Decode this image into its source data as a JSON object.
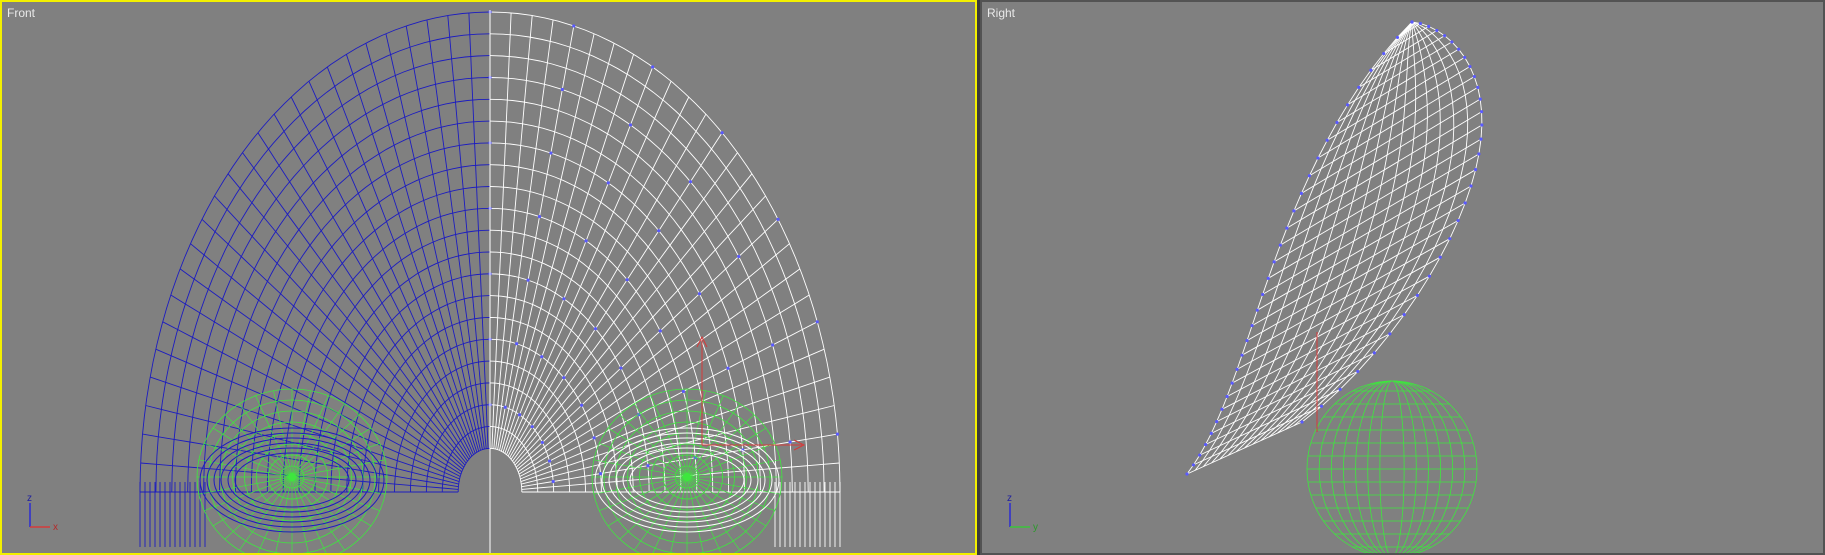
{
  "viewports": [
    {
      "label": "Front",
      "active": true,
      "axis": {
        "h": "x",
        "v": "z"
      }
    },
    {
      "label": "Right",
      "active": false,
      "axis": {
        "h": "y",
        "v": "z"
      }
    }
  ],
  "colors": {
    "background": "#808080",
    "active_border": "#f3f000",
    "inactive_border": "#535353",
    "mesh_unselected": "#1c1cc0",
    "mesh_selected": "#ffffff",
    "vertex": "#5a5aff",
    "eye_sphere": "#3ee63e",
    "gizmo_x": "#d63a3a",
    "gizmo_y": "#3ac43a",
    "gizmo_z": "#2a2ad6"
  }
}
